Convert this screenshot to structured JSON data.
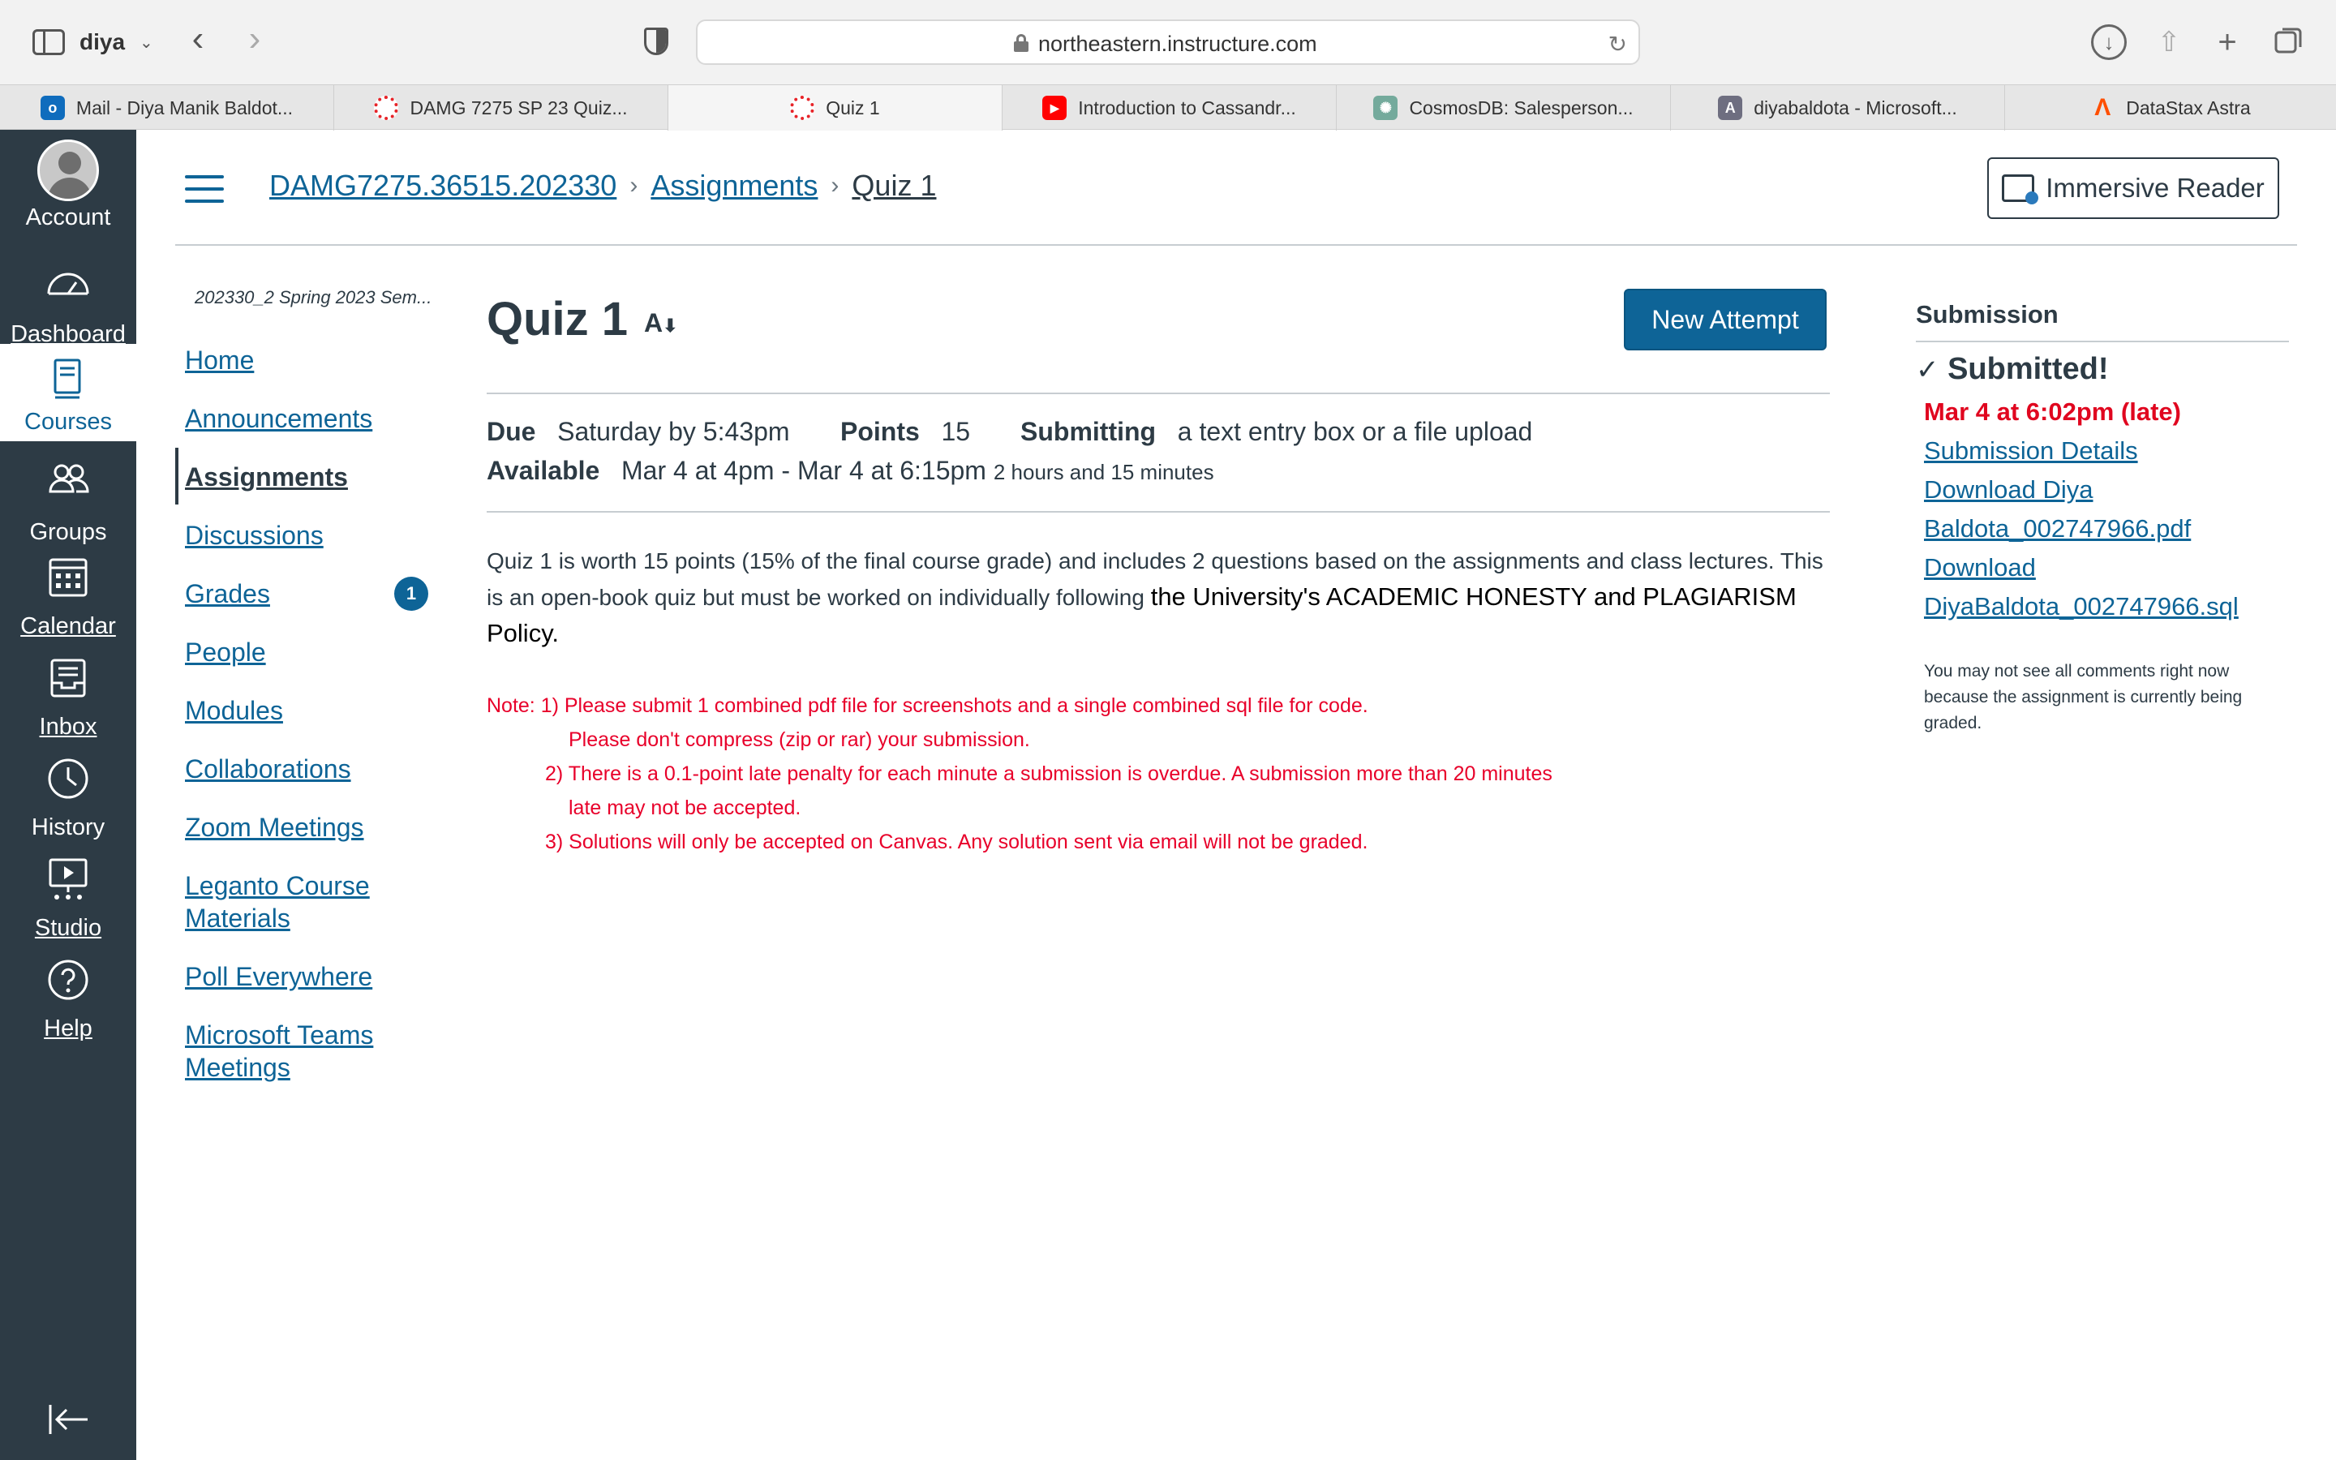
{
  "browser": {
    "profile_name": "diya",
    "url": "northeastern.instructure.com",
    "tabs": [
      {
        "label": "Mail - Diya Manik Baldot...",
        "icon": "outlook-icon",
        "color": "#0f6cbd"
      },
      {
        "label": "DAMG 7275 SP 23 Quiz...",
        "icon": "canvas-icon",
        "color": "#e72429"
      },
      {
        "label": "Quiz 1",
        "icon": "canvas-icon",
        "color": "#e72429"
      },
      {
        "label": "Introduction to Cassandr...",
        "icon": "youtube-icon",
        "color": "#ff0000"
      },
      {
        "label": "CosmosDB: Salesperson...",
        "icon": "chatgpt-icon",
        "color": "#74aa9c"
      },
      {
        "label": "diyabaldota - Microsoft...",
        "icon": "a-letter-icon",
        "color": "#6e6e80"
      },
      {
        "label": "DataStax Astra",
        "icon": "astra-icon",
        "color": "#ff4f00"
      }
    ],
    "active_tab_index": 2
  },
  "global_nav": {
    "items": [
      {
        "label": "Account",
        "icon": "avatar-icon"
      },
      {
        "label": "Dashboard",
        "icon": "dashboard-icon"
      },
      {
        "label": "Courses",
        "icon": "courses-icon"
      },
      {
        "label": "Groups",
        "icon": "groups-icon"
      },
      {
        "label": "Calendar",
        "icon": "calendar-icon"
      },
      {
        "label": "Inbox",
        "icon": "inbox-icon"
      },
      {
        "label": "History",
        "icon": "history-icon"
      },
      {
        "label": "Studio",
        "icon": "studio-icon"
      },
      {
        "label": "Help",
        "icon": "help-icon"
      }
    ],
    "active": "Courses"
  },
  "breadcrumb": {
    "course": "DAMG7275.36515.202330",
    "section": "Assignments",
    "current": "Quiz 1"
  },
  "immersive_reader_label": "Immersive Reader",
  "course_nav": {
    "term": "202330_2 Spring 2023 Sem...",
    "items": [
      "Home",
      "Announcements",
      "Assignments",
      "Discussions",
      "Grades",
      "People",
      "Modules",
      "Collaborations",
      "Zoom Meetings",
      "Leganto Course",
      "Materials",
      "Poll Everywhere",
      "Microsoft Teams",
      "Meetings"
    ],
    "active": "Assignments",
    "grades_badge": "1"
  },
  "assignment": {
    "title": "Quiz 1",
    "new_attempt_label": "New Attempt",
    "due_label": "Due",
    "due_value": "Saturday by 5:43pm",
    "points_label": "Points",
    "points_value": "15",
    "submitting_label": "Submitting",
    "submitting_value": "a text entry box or a file upload",
    "available_label": "Available",
    "available_value": "Mar 4 at 4pm - Mar 4 at 6:15pm",
    "available_duration": "2 hours and 15 minutes",
    "description_part1": "Quiz 1 is worth 15 points (15% of the final course grade) and includes 2 questions based on the assignments and class lectures. This is an open-book quiz but must be worked on individually following ",
    "description_part2": "the University's ACADEMIC HONESTY and PLAGIARISM Policy.",
    "notes": [
      "Note: 1) Please submit 1 combined pdf file for screenshots and a single combined sql file for code.",
      "Please don't compress (zip or rar) your submission.",
      "2) There is a 0.1-point late penalty for each minute a submission is overdue. A submission more than 20 minutes",
      "late may not be accepted.",
      "3) Solutions will only be accepted on Canvas. Any solution sent via email will not be graded."
    ]
  },
  "submission": {
    "heading": "Submission",
    "status": "Submitted!",
    "submitted_at": "Mar 4 at 6:02pm (late)",
    "details_link": "Submission Details",
    "download_1a": "Download Diya",
    "download_1b": "Baldota_002747966.pdf",
    "download_2a": "Download",
    "download_2b": "DiyaBaldota_002747966.sql",
    "comment_note": "You may not see all comments right now because the assignment is currently being graded."
  },
  "colors": {
    "nav_bg": "#2d3b45",
    "link": "#0e6497",
    "button": "#0e6497",
    "late_red": "#e0061f",
    "note_red": "#e8002a"
  }
}
